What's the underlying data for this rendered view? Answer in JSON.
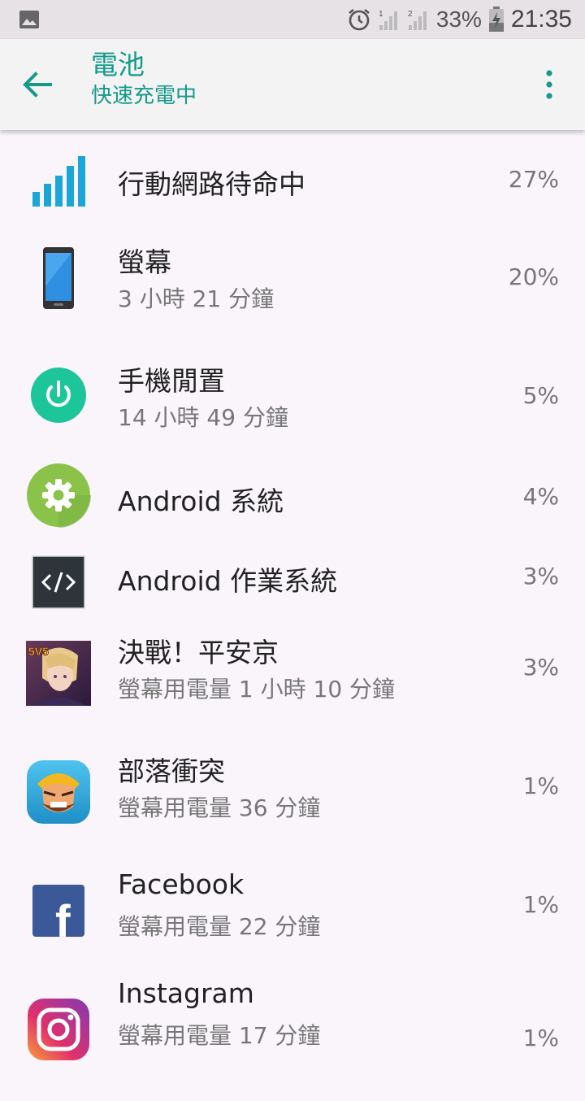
{
  "status_bar": {
    "battery_percent": "33%",
    "time": "21:35",
    "icons": [
      "image-icon",
      "alarm-icon",
      "signal-sim1-icon",
      "signal-sim2-icon",
      "battery-charging-icon"
    ]
  },
  "app_bar": {
    "title": "電池",
    "subtitle": "快速充電中",
    "back_icon": "back-arrow-icon",
    "more_icon": "more-vert-icon"
  },
  "items": [
    {
      "label": "行動網路待命中",
      "sub": "",
      "percent": "27%",
      "icon": "cell-signal-icon"
    },
    {
      "label": "螢幕",
      "sub": "3 小時 21 分鐘",
      "percent": "20%",
      "icon": "phone-screen-icon"
    },
    {
      "label": "手機閒置",
      "sub": "14 小時 49 分鐘",
      "percent": "5%",
      "icon": "power-icon"
    },
    {
      "label": "Android 系統",
      "sub": "",
      "percent": "4%",
      "icon": "android-system-gear-icon"
    },
    {
      "label": "Android 作業系統",
      "sub": "",
      "percent": "3%",
      "icon": "code-brackets-icon"
    },
    {
      "label": "決戰！平安京",
      "sub": "螢幕用電量 1 小時 10 分鐘",
      "percent": "3%",
      "icon": "onmyoji-arena-app-icon",
      "badge": "5V5"
    },
    {
      "label": "部落衝突",
      "sub": "螢幕用電量 36 分鐘",
      "percent": "1%",
      "icon": "clash-of-clans-app-icon"
    },
    {
      "label": "Facebook",
      "sub": "螢幕用電量 22 分鐘",
      "percent": "1%",
      "icon": "facebook-icon",
      "glyph": "f"
    },
    {
      "label": "Instagram",
      "sub": "螢幕用電量 17 分鐘",
      "percent": "1%",
      "icon": "instagram-icon"
    }
  ],
  "colors": {
    "accent": "#159a8a",
    "signal_blue": "#1aa6d6",
    "power_green": "#1cc59a",
    "android_green": "#8bc34a",
    "facebook_blue": "#3b5998"
  }
}
